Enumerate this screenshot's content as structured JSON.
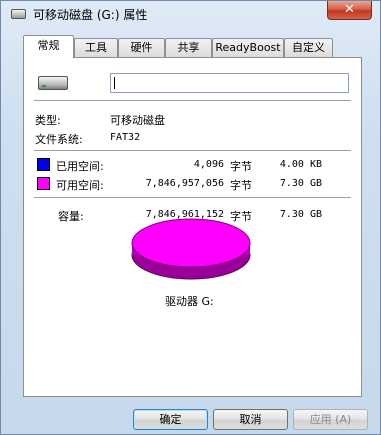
{
  "window": {
    "title": "可移动磁盘 (G:) 属性",
    "close_label": "✕"
  },
  "tabs": [
    {
      "label": "常规",
      "active": true
    },
    {
      "label": "工具"
    },
    {
      "label": "硬件"
    },
    {
      "label": "共享"
    },
    {
      "label": "ReadyBoost"
    },
    {
      "label": "自定义"
    }
  ],
  "general": {
    "name_value": "",
    "type_label": "类型:",
    "type_value": "可移动磁盘",
    "fs_label": "文件系统:",
    "fs_value": "FAT32",
    "used": {
      "label": "已用空间:",
      "bytes": "4,096",
      "unit": "字节",
      "size": "4.00 KB",
      "color": "#0000ff"
    },
    "free": {
      "label": "可用空间:",
      "bytes": "7,846,957,056",
      "unit": "字节",
      "size": "7.30 GB",
      "color": "#ff00ff"
    },
    "capacity": {
      "label": "容量:",
      "bytes": "7,846,961,152",
      "unit": "字节",
      "size": "7.30 GB"
    },
    "drive_label": "驱动器 G:",
    "used_fraction": 5e-07
  },
  "buttons": {
    "ok": "确定",
    "cancel": "取消",
    "apply": "应用 (A)"
  }
}
